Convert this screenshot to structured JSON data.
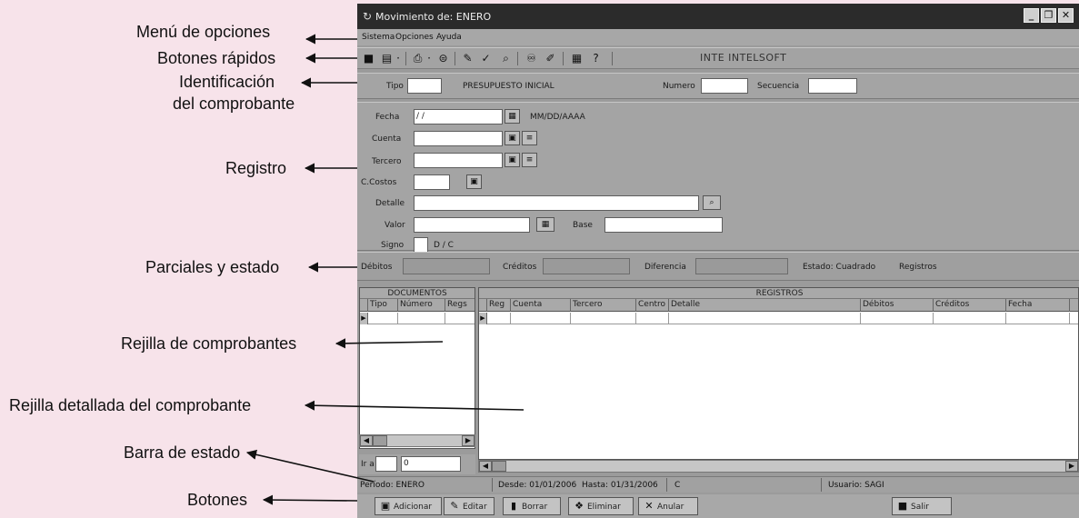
{
  "window": {
    "title": "Movimiento de: ENERO",
    "controls": {
      "minimize": "_",
      "restore": "❐",
      "close": "✕"
    }
  },
  "menu": {
    "items": [
      "Sistema",
      "Opciones",
      "Ayuda"
    ]
  },
  "toolbar": {
    "company": "INTE INTELSOFT",
    "icons": [
      "save-icon",
      "new-doc-icon",
      "print-icon",
      "export-icon",
      "edit-record-icon",
      "check-icon",
      "search-doc-icon",
      "binoculars-icon",
      "pencil-icon",
      "calculator-icon",
      "help-icon"
    ]
  },
  "header": {
    "tipo_label": "Tipo",
    "tipo_value": "",
    "document_type": "PRESUPUESTO INICIAL",
    "numero_label": "Numero",
    "numero_value": "",
    "secuencia_label": "Secuencia",
    "secuencia_value": ""
  },
  "registro": {
    "fecha_label": "Fecha",
    "fecha_value": "/ /",
    "fecha_format": "MM/DD/AAAA",
    "cuenta_label": "Cuenta",
    "tercero_label": "Tercero",
    "ccostos_label": "C.Costos",
    "detalle_label": "Detalle",
    "valor_label": "Valor",
    "base_label": "Base",
    "signo_label": "Signo",
    "signo_options": "D / C"
  },
  "parciales": {
    "debitos_label": "Débitos",
    "creditos_label": "Créditos",
    "diferencia_label": "Diferencia",
    "estado": "Estado: Cuadrado",
    "registros_label": "Registros"
  },
  "documentos_grid": {
    "title": "DOCUMENTOS",
    "columns": [
      "Tipo",
      "Número",
      "Regs"
    ],
    "ir_label": "Ir a",
    "ir_value": "0"
  },
  "registros_grid": {
    "title": "REGISTROS",
    "columns": [
      "Reg",
      "Cuenta",
      "Tercero",
      "Centro",
      "Detalle",
      "Débitos",
      "Créditos",
      "Fecha"
    ]
  },
  "statusbar": {
    "periodo": "Período: ENERO",
    "desde": "Desde: 01/01/2006",
    "hasta": "Hasta: 01/31/2006",
    "c": "C",
    "usuario": "Usuario: SAGI"
  },
  "buttons": {
    "adicionar": "Adicionar",
    "editar": "Editar",
    "borrar": "Borrar",
    "eliminar": "Eliminar",
    "anular": "Anular",
    "salir": "Salir"
  },
  "annotations": {
    "menu": "Menú de opciones",
    "quick_buttons": "Botones rápidos",
    "ident_line1": "Identificación",
    "ident_line2": "del comprobante",
    "registro": "Registro",
    "parciales": "Parciales y estado",
    "rejilla_comprobantes": "Rejilla de comprobantes",
    "rejilla_detallada": "Rejilla detallada del comprobante",
    "barra_estado": "Barra de estado",
    "botones": "Botones"
  }
}
